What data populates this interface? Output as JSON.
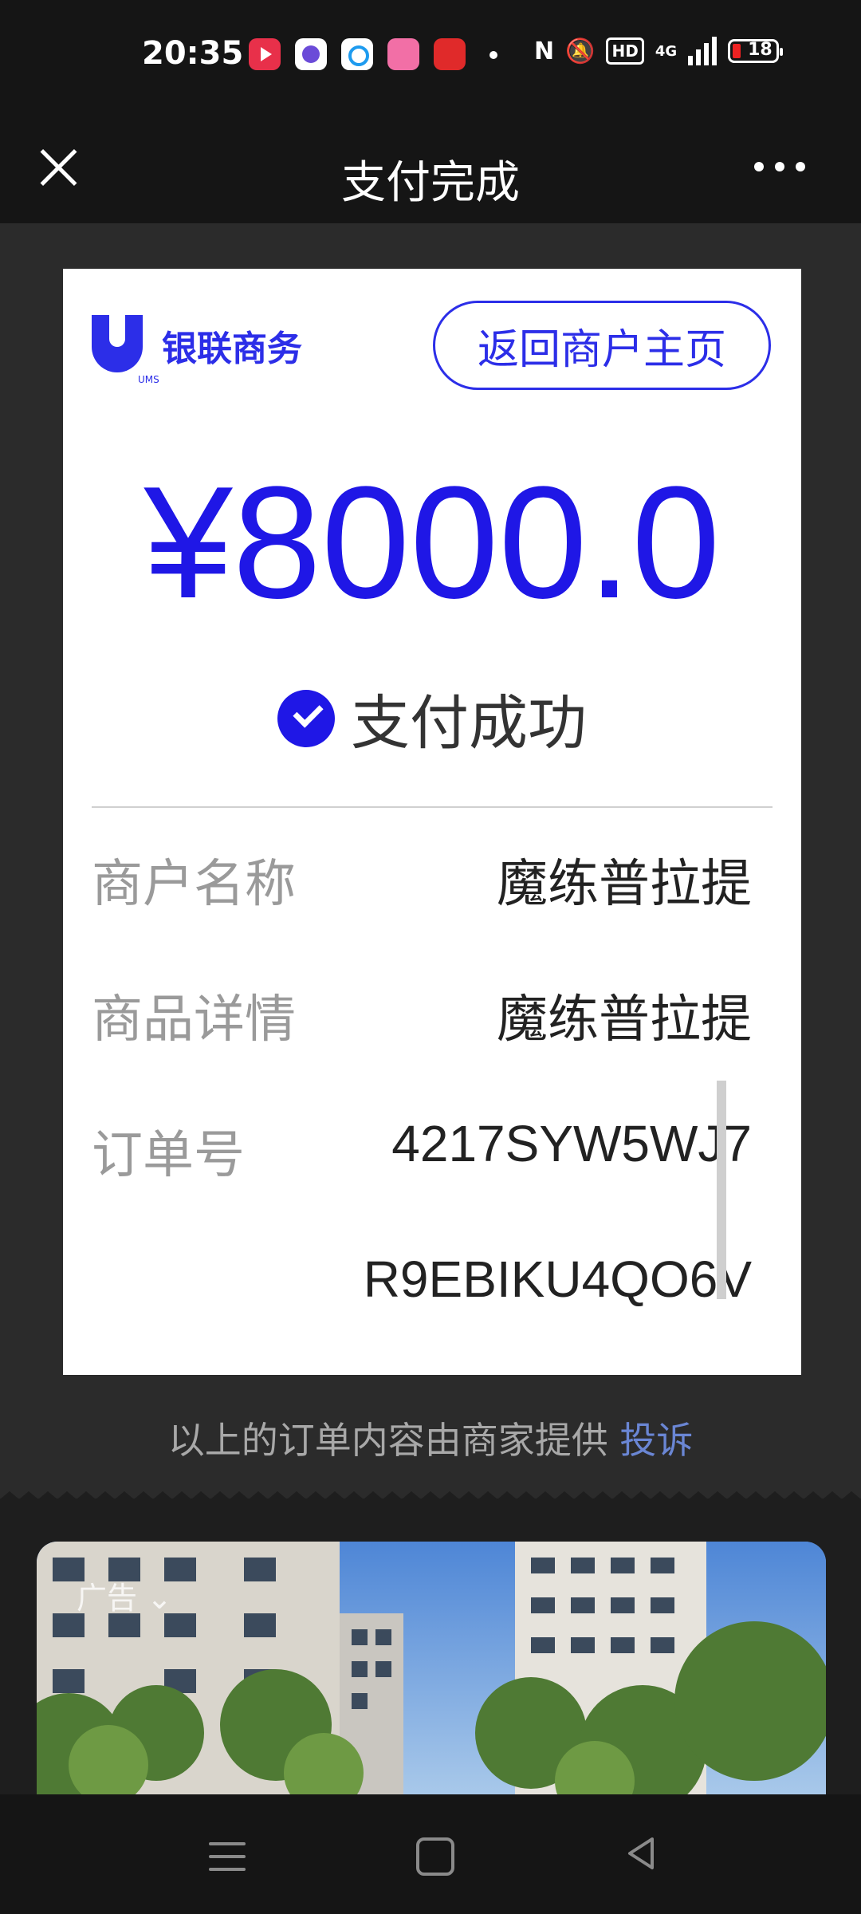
{
  "status_bar": {
    "time": "20:35",
    "network": "4G",
    "battery": "18",
    "hd": "HD"
  },
  "nav": {
    "title": "支付完成"
  },
  "receipt": {
    "brand": "银联商务",
    "brand_sub": "UMS",
    "home_button": "返回商户主页",
    "amount": "¥8000.0",
    "status": "支付成功",
    "rows": [
      {
        "label": "商户名称",
        "value": "魔练普拉提"
      },
      {
        "label": "商品详情",
        "value": "魔练普拉提"
      },
      {
        "label": "订单号",
        "value": "4217SYW5WJ7"
      }
    ],
    "order_no_cont": "R9EBIKU4QO6V"
  },
  "footer": {
    "note": "以上的订单内容由商家提供",
    "complain": "投诉"
  },
  "ad": {
    "label": "广告"
  },
  "colors": {
    "accent": "#1f17e6",
    "brand": "#2c2ee8"
  }
}
